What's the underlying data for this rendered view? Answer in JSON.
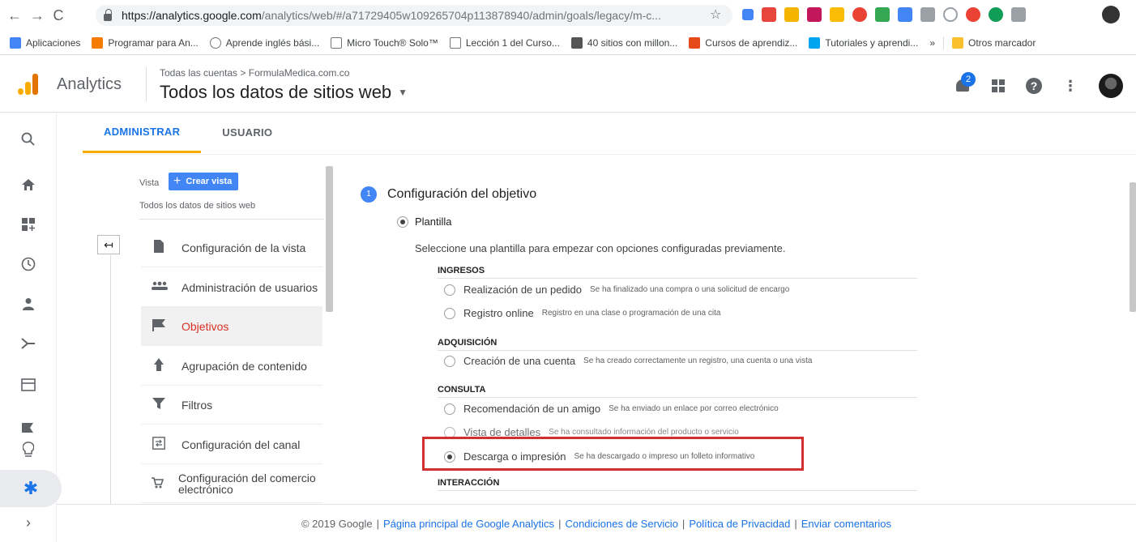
{
  "browser": {
    "url_host": "https://analytics.google.com",
    "url_path": "/analytics/web/#/a71729405w109265704p113878940/admin/goals/legacy/m-c...",
    "bookmarks": [
      "Aplicaciones",
      "Programar para An...",
      "Aprende inglés bási...",
      "Micro Touch® Solo™",
      "Lección 1 del Curso...",
      "40 sitios con millon...",
      "Cursos de aprendiz...",
      "Tutoriales y aprendi..."
    ],
    "bookmarks_more": "»",
    "other_bookmarks": "Otros marcador"
  },
  "header": {
    "product": "Analytics",
    "breadcrumb": "Todas las cuentas > FormulaMedica.com.co",
    "account_title": "Todos los datos de sitios web",
    "notification_count": "2"
  },
  "tabs": [
    {
      "label": "ADMINISTRAR"
    },
    {
      "label": "USUARIO"
    }
  ],
  "admin_nav": {
    "vista_label": "Vista",
    "create_button": "Crear vista",
    "view_name": "Todos los datos de sitios web",
    "items": [
      {
        "label": "Configuración de la vista",
        "icon": "document-icon"
      },
      {
        "label": "Administración de usuarios",
        "icon": "users-icon"
      },
      {
        "label": "Objetivos",
        "icon": "flag-icon"
      },
      {
        "label": "Agrupación de contenido",
        "icon": "person-walk-icon"
      },
      {
        "label": "Filtros",
        "icon": "filter-icon"
      },
      {
        "label": "Configuración del canal",
        "icon": "channel-icon"
      },
      {
        "label": "Configuración del comercio electrónico",
        "icon": "cart-icon"
      }
    ]
  },
  "goal_setup": {
    "step_number": "1",
    "title": "Configuración del objetivo",
    "template_label": "Plantilla",
    "intro": "Seleccione una plantilla para empezar con opciones configuradas previamente.",
    "categories": [
      {
        "label": "INGRESOS",
        "options": [
          {
            "name": "Realización de un pedido",
            "desc": "Se ha finalizado una compra o una solicitud de encargo",
            "selected": false
          },
          {
            "name": "Registro online",
            "desc": "Registro en una clase o programación de una cita",
            "selected": false
          }
        ]
      },
      {
        "label": "ADQUISICIÓN",
        "options": [
          {
            "name": "Creación de una cuenta",
            "desc": "Se ha creado correctamente un registro, una cuenta o una vista",
            "selected": false
          }
        ]
      },
      {
        "label": "CONSULTA",
        "options": [
          {
            "name": "Recomendación de un amigo",
            "desc": "Se ha enviado un enlace por correo electrónico",
            "selected": false
          },
          {
            "name": "Vista de detalles",
            "desc": "Se ha consultado información del producto o servicio",
            "selected": false
          },
          {
            "name": "Descarga o impresión",
            "desc": "Se ha descargado o impreso un folleto informativo",
            "selected": true
          }
        ]
      },
      {
        "label": "INTERACCIÓN",
        "options": []
      }
    ]
  },
  "footer": {
    "copyright": "© 2019 Google",
    "links": [
      "Página principal de Google Analytics",
      "Condiciones de Servicio",
      "Política de Privacidad",
      "Enviar comentarios"
    ],
    "separator": "|"
  },
  "colors": {
    "accent": "#1a73e8",
    "tab_underline": "#f9ab00",
    "selected_nav": "#d93025",
    "highlight_box": "#d32f2f"
  }
}
